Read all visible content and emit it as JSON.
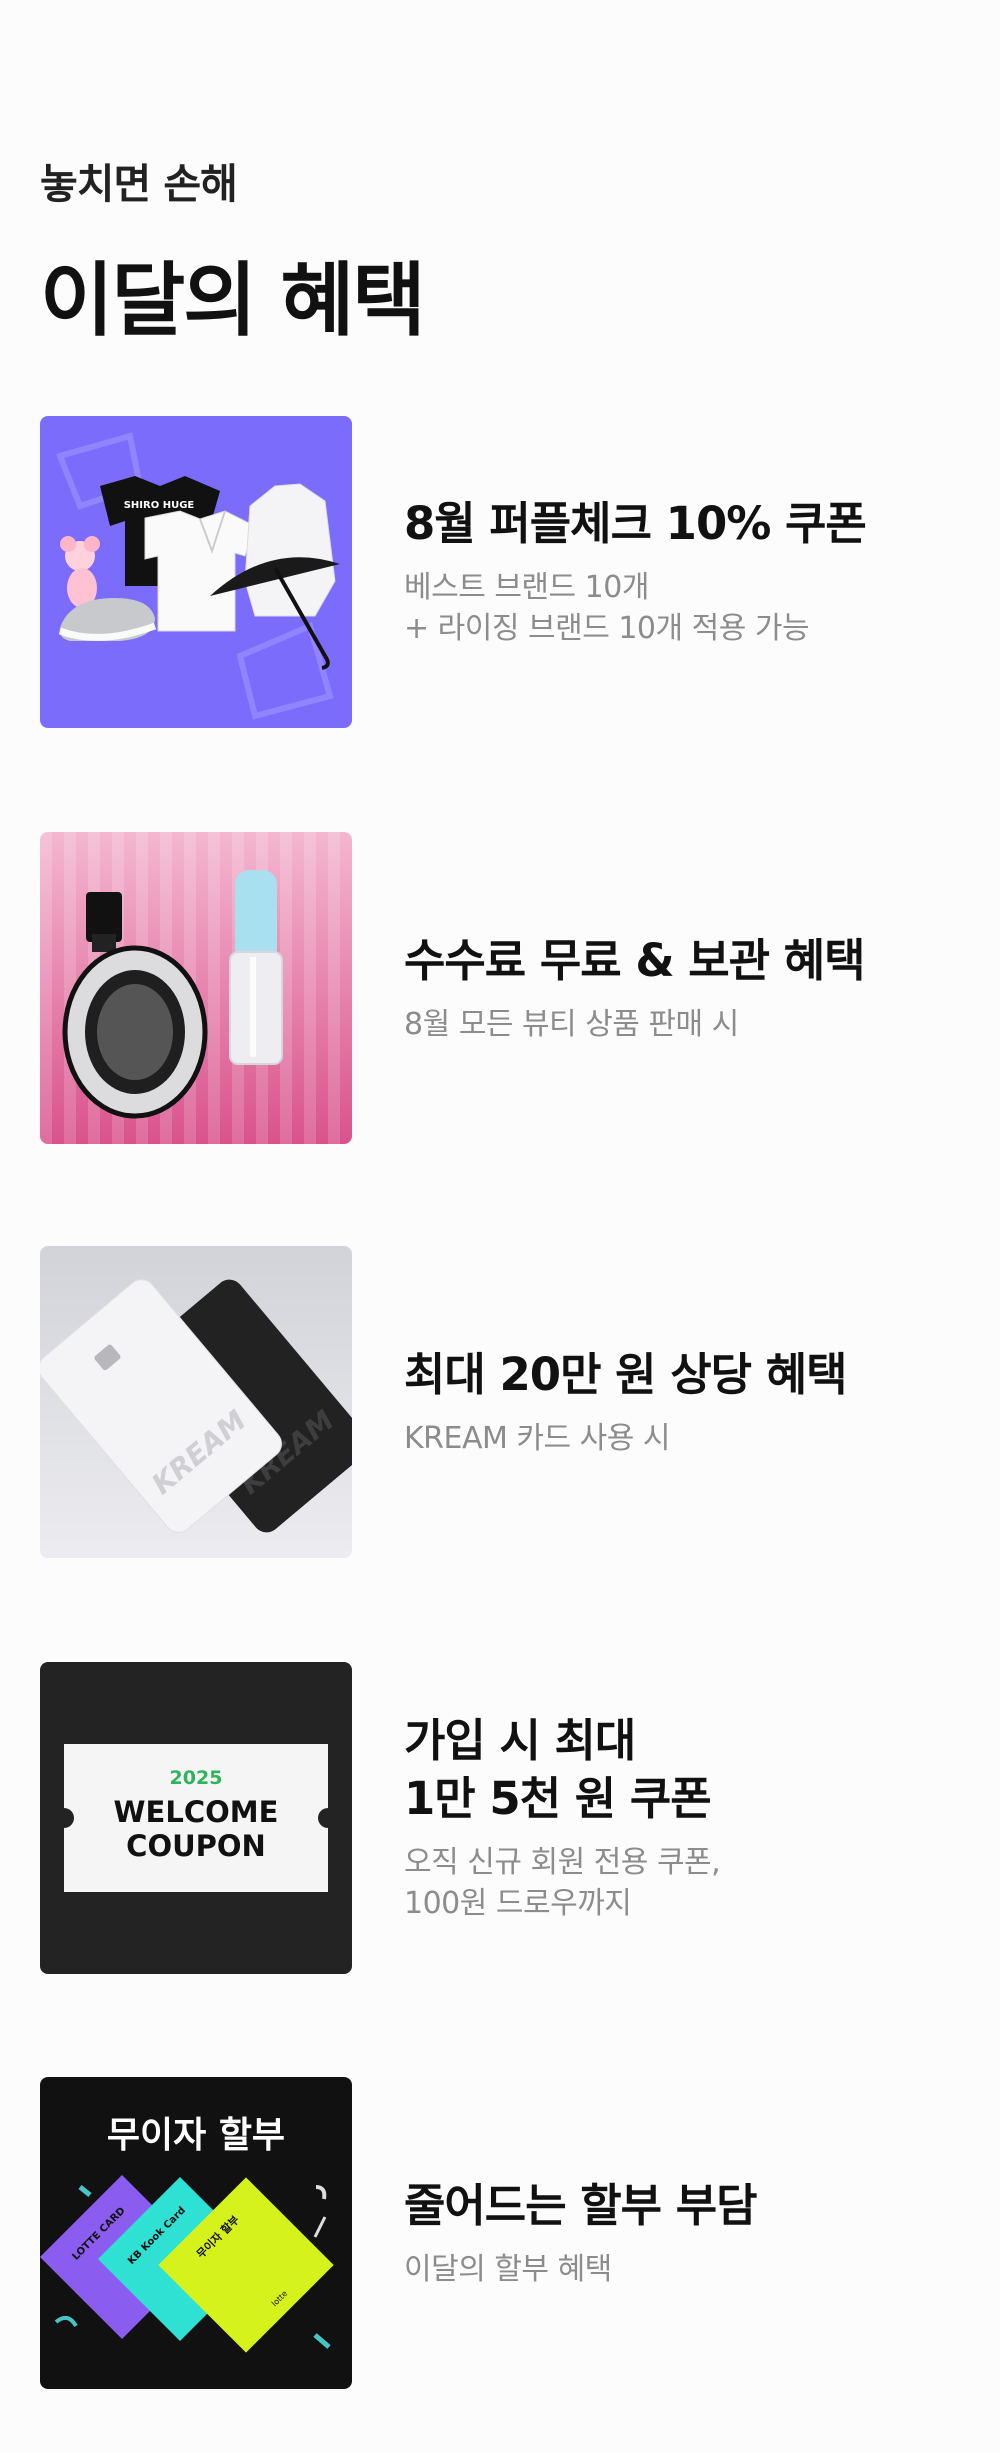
{
  "header": {
    "eyebrow": "놓치면 손해",
    "title": "이달의 혜택"
  },
  "benefits": [
    {
      "title": "8월 퍼플체크 10% 쿠폰",
      "desc": "베스트 브랜드 10개\n+ 라이징 브랜드 10개 적용 가능",
      "thumb": {
        "tee_text": "SHIRO HUGE"
      }
    },
    {
      "title": "수수료 무료 & 보관 혜택",
      "desc": "8월 모든 뷰티 상품 판매 시"
    },
    {
      "title": "최대 20만 원 상당 혜택",
      "desc": "KREAM 카드 사용 시",
      "thumb": {
        "card_text": "KREAM"
      }
    },
    {
      "title": "가입 시 최대\n1만 5천 원 쿠폰",
      "desc": "오직 신규 회원 전용 쿠폰,\n100원 드로우까지",
      "thumb": {
        "year": "2025",
        "line1": "WELCOME",
        "line2": "COUPON"
      }
    },
    {
      "title": "줄어드는 할부 부담",
      "desc": "이달의 할부 혜택",
      "thumb": {
        "heading": "무이자 할부",
        "card_a": "LOTTE CARD",
        "card_b": "KB Kook Card",
        "card_c": "무이자 할부",
        "card_c_sub": "lotte"
      }
    }
  ],
  "colors": {
    "purple_bg": "#7b6cfb",
    "pink_bg": "#e47aa8",
    "card_bg": "#dfe0e6",
    "dark_bg": "#232323",
    "black_bg": "#111111",
    "coupon_green": "#2fb35b"
  }
}
